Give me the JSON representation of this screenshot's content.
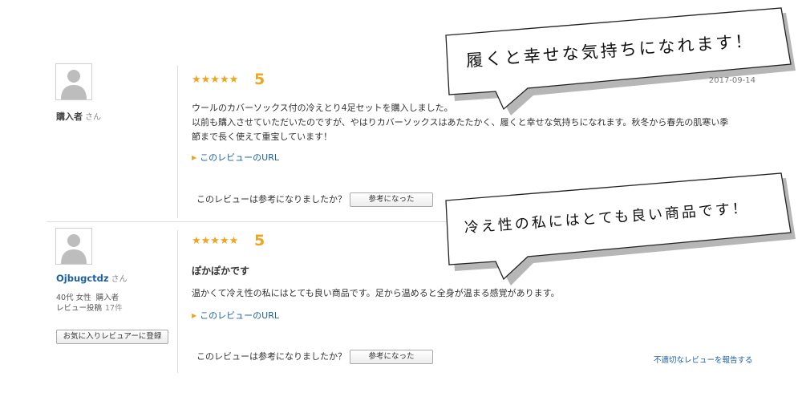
{
  "reviews": [
    {
      "reviewer_name": "購入者",
      "reviewer_suffix": "さん",
      "stars": "★★★★★",
      "score": "5",
      "date": "2017-09-14",
      "body_line1": "ウールのカバーソックス付の冷えとり4足セットを購入しました。",
      "body_line2": "以前も購入させていただいたのですが、やはりカバーソックスはあたたかく、履くと幸せな気持ちになれます。秋冬から春先の肌寒い季",
      "body_line3": "節まで長く使えて重宝しています！",
      "url_link": "このレビューのURL",
      "helpful_question": "このレビューは参考になりましたか？",
      "helpful_button": "参考になった"
    },
    {
      "reviewer_name": "Ojbugctdz",
      "reviewer_suffix": "さん",
      "age_gender": "40代 女性",
      "buyer_label": "購入者",
      "review_count_label": "レビュー投稿",
      "review_count": "17件",
      "favorite_button": "お気に入りレビュアーに登録",
      "stars": "★★★★★",
      "score": "5",
      "title": "ぽかぽかです",
      "body_line1": "温かくて冷え性の私にはとても良い商品です。足から温めると全身が温まる感覚があります。",
      "url_link": "このレビューのURL",
      "helpful_question": "このレビューは参考になりましたか？",
      "helpful_button": "参考になった",
      "report_link": "不適切なレビューを報告する"
    }
  ],
  "callouts": [
    {
      "text": "履くと幸せな気持ちになれます！"
    },
    {
      "text": "冷え性の私にはとても良い商品です！"
    }
  ],
  "colors": {
    "star": "#f0a41f",
    "link": "#1a5fa8",
    "divider": "#dddddd"
  }
}
